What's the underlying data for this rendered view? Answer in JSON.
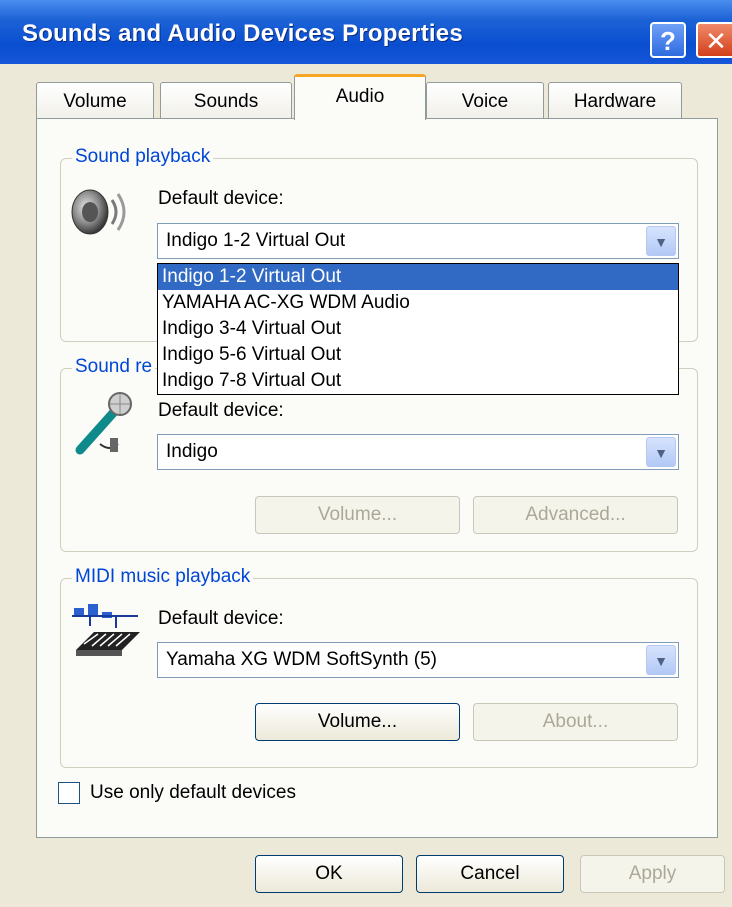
{
  "window": {
    "title": "Sounds and Audio Devices Properties",
    "help_glyph": "?",
    "close_glyph": "✕"
  },
  "tabs": [
    "Volume",
    "Sounds",
    "Audio",
    "Voice",
    "Hardware"
  ],
  "active_tab": "Audio",
  "playback": {
    "legend": "Sound playback",
    "label": "Default device:",
    "value": "Indigo 1-2 Virtual Out",
    "options": [
      "Indigo 1-2 Virtual Out",
      "YAMAHA AC-XG WDM Audio",
      "Indigo 3-4 Virtual Out",
      "Indigo 5-6 Virtual Out",
      "Indigo 7-8 Virtual Out"
    ],
    "icon": "speaker-icon"
  },
  "recording": {
    "legend": "Sound re",
    "label": "Default device:",
    "value": "Indigo",
    "volume_label": "Volume...",
    "advanced_label": "Advanced...",
    "icon": "microphone-icon"
  },
  "midi": {
    "legend": "MIDI music playback",
    "label": "Default device:",
    "value": "Yamaha XG WDM SoftSynth (5)",
    "volume_label": "Volume...",
    "about_label": "About...",
    "icon": "midi-keyboard-icon"
  },
  "default_only": {
    "label": "Use only default devices",
    "checked": false
  },
  "footer": {
    "ok": "OK",
    "cancel": "Cancel",
    "apply": "Apply"
  },
  "colors": {
    "title_bar": "#0a4ed0",
    "accent": "#316ac5",
    "legend": "#0046d5"
  }
}
